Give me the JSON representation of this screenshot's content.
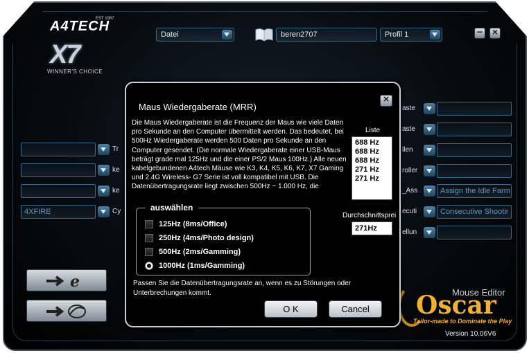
{
  "header": {
    "brand": "A4TECH",
    "brand_est": "EST 1987",
    "model": "X7",
    "tagline": "WINNER'S CHOICE",
    "file_menu": "Datei",
    "profile_name": "beren2707",
    "profile_select": "Profil 1"
  },
  "left_rows": [
    {
      "field": "",
      "label": "Tr"
    },
    {
      "field": "",
      "label": "ke"
    },
    {
      "field": "",
      "label": "ke"
    },
    {
      "field": "4XFIRE",
      "label": "Cy"
    }
  ],
  "right_rows": [
    {
      "label": "aste",
      "field": ""
    },
    {
      "label": "aste",
      "field": ""
    },
    {
      "label": "llen",
      "field": ""
    },
    {
      "label": "roller",
      "field": ""
    },
    {
      "label": "_Ass",
      "field": "Assign the Idle Farm"
    },
    {
      "label": "ecuti",
      "field": "Consecutive Shootir"
    },
    {
      "label": "ellun",
      "field": ""
    }
  ],
  "branding": {
    "mouse_editor": "Mouse Editor",
    "oscar": "Oscar",
    "oscar_tagline": "Tailor-made to Dominate the Play",
    "version": "Version 10.06V6"
  },
  "dialog": {
    "title": "Maus Wiedergaberate (MRR)",
    "description": "Die Maus Wiedergaberate ist die Frequenz der Maus wie viele Daten pro Sekunde an den Computer übermittelt werden. Das bedeutet, bei 500Hz Wiedergaberate werden 500 Daten pro Sekunde an den Computer gesendet. (Die normale Wiedergaberate einer USB-Maus beträgt grade mal 125Hz und die einer PS/2 Maus 100Hz.) Alle neuen kabelgebundenen A4tech Mäuse wie K3, K4, K5, K6, K7, X7 Gaming und 2.4G Wireless- G7 Serie ist voll kompatibel mit USB. Die Datenübertragungsrate liegt zwischen 500Hz ~ 1.000 Hz, die",
    "list_label": "Liste",
    "list_items": [
      "688 Hz",
      "688 Hz",
      "688 Hz",
      "271 Hz",
      "271 Hz"
    ],
    "average_label": "Durchschnittsprei",
    "average_value": "271Hz",
    "group_title": "auswählen",
    "options": [
      {
        "label": "125Hz (8ms/Office)",
        "selected": false
      },
      {
        "label": "250Hz (4ms/Photo design)",
        "selected": false
      },
      {
        "label": "500Hz (2ms/Gamming)",
        "selected": false
      },
      {
        "label": "1000Hz (1ms/Gamming)",
        "selected": true
      }
    ],
    "hint": "Passen Sie die Datenübertragungsrate an, wenn es zu Störungen oder Unterbrechungen kommt.",
    "ok_label": "O K",
    "cancel_label": "Cancel"
  }
}
